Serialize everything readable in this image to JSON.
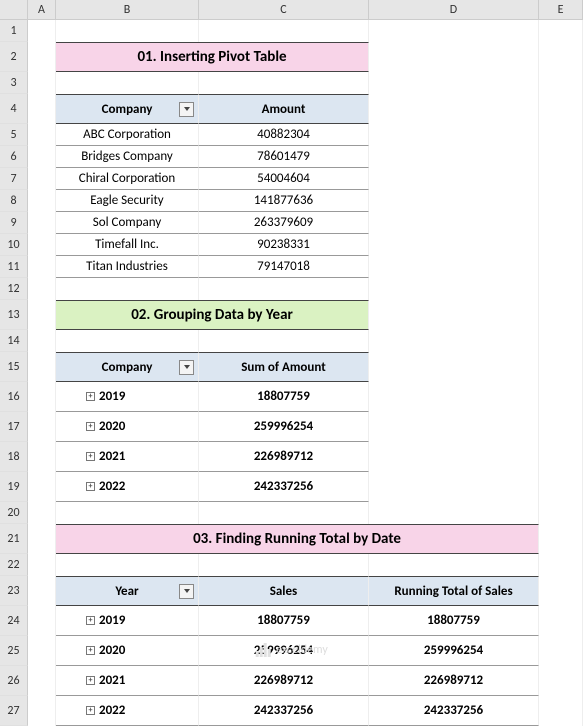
{
  "columns": [
    "A",
    "B",
    "C",
    "D",
    "E"
  ],
  "section1": {
    "title": "01. Inserting Pivot Table",
    "headers": {
      "company": "Company",
      "amount": "Amount"
    },
    "rows": [
      {
        "company": "ABC Corporation",
        "amount": "40882304"
      },
      {
        "company": "Bridges Company",
        "amount": "78601479"
      },
      {
        "company": "Chiral Corporation",
        "amount": "54004604"
      },
      {
        "company": "Eagle Security",
        "amount": "141877636"
      },
      {
        "company": "Sol Company",
        "amount": "263379609"
      },
      {
        "company": "Timefall Inc.",
        "amount": "90238331"
      },
      {
        "company": "Titan Industries",
        "amount": "79147018"
      }
    ]
  },
  "section2": {
    "title": "02. Grouping Data by Year",
    "headers": {
      "company": "Company",
      "sum": "Sum of Amount"
    },
    "rows": [
      {
        "year": "2019",
        "sum": "18807759"
      },
      {
        "year": "2020",
        "sum": "259996254"
      },
      {
        "year": "2021",
        "sum": "226989712"
      },
      {
        "year": "2022",
        "sum": "242337256"
      }
    ]
  },
  "section3": {
    "title": "03. Finding Running Total by Date",
    "headers": {
      "year": "Year",
      "sales": "Sales",
      "running": "Running Total of Sales"
    },
    "rows": [
      {
        "year": "2019",
        "sales": "18807759",
        "running": "18807759"
      },
      {
        "year": "2020",
        "sales": "259996254",
        "running": "259996254"
      },
      {
        "year": "2021",
        "sales": "226989712",
        "running": "226989712"
      },
      {
        "year": "2022",
        "sales": "242337256",
        "running": "242337256"
      }
    ]
  },
  "watermark": "exceldemy"
}
